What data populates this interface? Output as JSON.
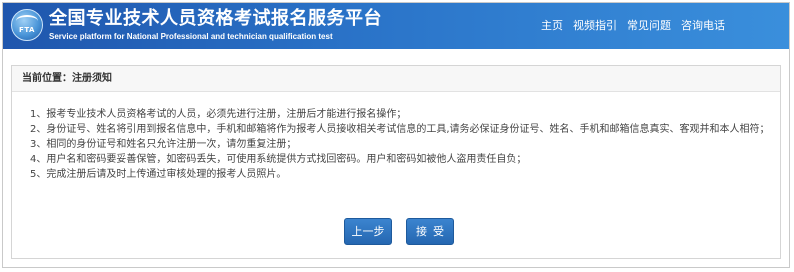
{
  "header": {
    "logo_text": "FTA",
    "title": "全国专业技术人员资格考试报名服务平台",
    "subtitle": "Service platform for National Professional and technician qualification test",
    "nav": [
      "主页",
      "视频指引",
      "常见问题",
      "咨询电话"
    ]
  },
  "breadcrumb": "当前位置：注册须知",
  "rules": [
    "1、报考专业技术人员资格考试的人员，必须先进行注册，注册后才能进行报名操作；",
    "2、身份证号、姓名将引用到报名信息中，手机和邮箱将作为报考人员接收相关考试信息的工具,请务必保证身份证号、姓名、手机和邮箱信息真实、客观并和本人相符；",
    "3、相同的身份证号和姓名只允许注册一次，请勿重复注册；",
    "4、用户名和密码要妥善保管，如密码丢失，可使用系统提供方式找回密码。用户和密码如被他人盗用责任自负；",
    "5、完成注册后请及时上传通过审核处理的报考人员照片。"
  ],
  "buttons": {
    "prev": "上一步",
    "accept": "接受"
  }
}
